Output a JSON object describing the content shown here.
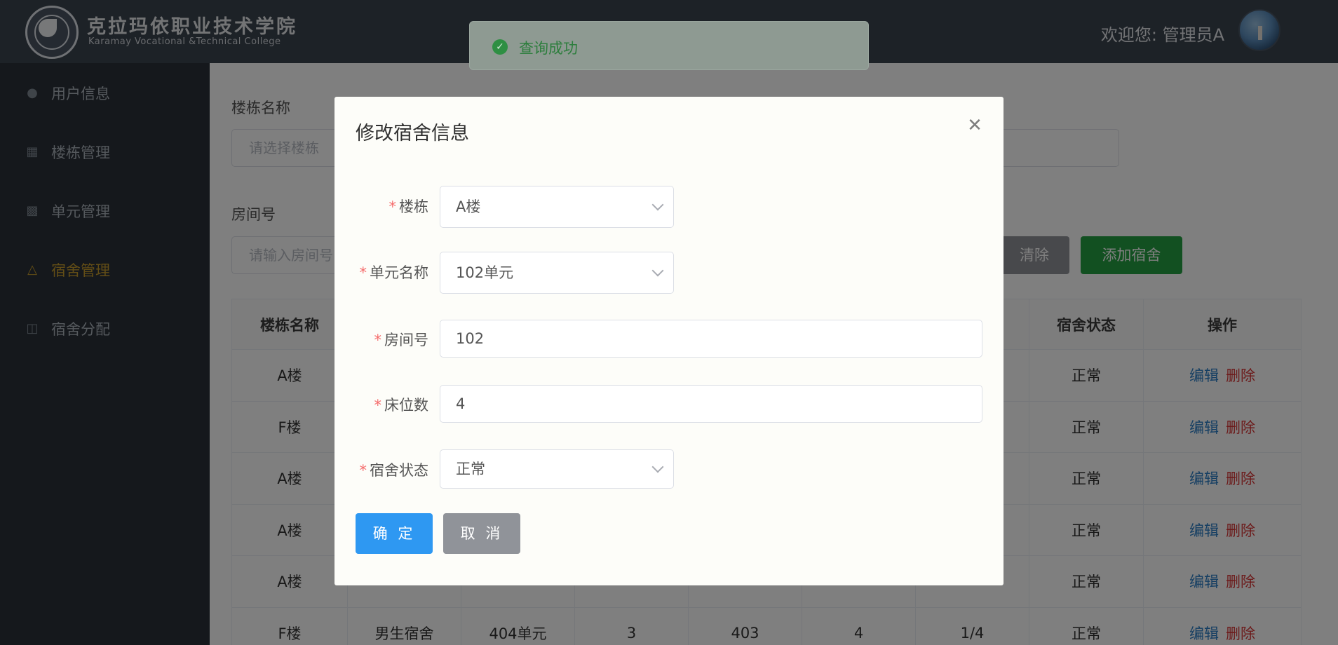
{
  "header": {
    "college_name_cn": "克拉玛依职业技术学院",
    "college_name_en": "Karamay Vocational &Technical College",
    "welcome": "欢迎您: 管理员A"
  },
  "toast": {
    "message": "查询成功",
    "icon": "check-circle-icon",
    "color": "#2d7e3d"
  },
  "sidebar": {
    "items": [
      {
        "label": "用户信息",
        "icon": "user-icon"
      },
      {
        "label": "楼栋管理",
        "icon": "building-icon"
      },
      {
        "label": "单元管理",
        "icon": "unit-icon"
      },
      {
        "label": "宿舍管理",
        "icon": "lamp-icon",
        "active": true
      },
      {
        "label": "宿舍分配",
        "icon": "assign-icon"
      }
    ],
    "active_color": "#c59a2c"
  },
  "filters": {
    "building_label": "楼栋名称",
    "building_placeholder": "请选择楼栋",
    "room_label": "房间号",
    "room_placeholder": "请输入房间号",
    "clear_label": "清除",
    "add_label": "添加宿舍"
  },
  "table": {
    "headers": [
      "楼栋名称",
      "",
      "",
      "",
      "",
      "",
      "",
      "宿舍状态",
      "操作"
    ],
    "rows": [
      [
        "A楼",
        "",
        "",
        "",
        "",
        "",
        "",
        "正常"
      ],
      [
        "F楼",
        "",
        "",
        "",
        "",
        "",
        "",
        "正常"
      ],
      [
        "A楼",
        "",
        "",
        "",
        "",
        "",
        "",
        "正常"
      ],
      [
        "A楼",
        "",
        "",
        "",
        "",
        "",
        "",
        "正常"
      ],
      [
        "A楼",
        "",
        "",
        "",
        "",
        "",
        "",
        "正常"
      ],
      [
        "F楼",
        "男生宿舍",
        "404单元",
        "3",
        "403",
        "4",
        "1/4",
        "正常"
      ]
    ],
    "edit_label": "编辑",
    "delete_label": "删除"
  },
  "dialog": {
    "title": "修改宿舍信息",
    "required_mark": "*",
    "fields": {
      "building": {
        "label": "楼栋",
        "value": "A楼"
      },
      "unit": {
        "label": "单元名称",
        "value": "102单元"
      },
      "room": {
        "label": "房间号",
        "value": "102"
      },
      "beds": {
        "label": "床位数",
        "value": "4"
      },
      "status": {
        "label": "宿舍状态",
        "value": "正常"
      }
    },
    "confirm_label": "确 定",
    "cancel_label": "取 消"
  },
  "colors": {
    "header_bg": "#3b444f",
    "sidebar_bg": "#2b3138",
    "primary": "#2e98f2",
    "success": "#24a142",
    "danger": "#d93636"
  }
}
